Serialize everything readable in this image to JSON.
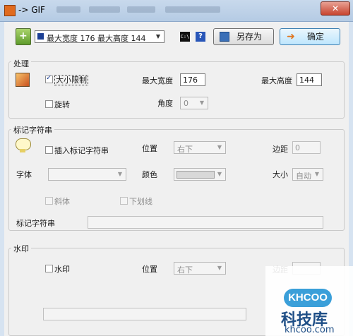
{
  "window": {
    "title": "-> GIF",
    "close_glyph": "✕"
  },
  "toolbar": {
    "preset_value": "最大宽度 176 最大高度 144",
    "cmd_icon_text": "C:\\",
    "help_icon_text": "?",
    "save_as_label": "另存为",
    "ok_label": "确定"
  },
  "processing": {
    "title": "处理",
    "size_limit_label": "大小限制",
    "size_limit_checked": true,
    "max_width_label": "最大宽度",
    "max_width_value": "176",
    "max_height_label": "最大高度",
    "max_height_value": "144",
    "rotate_label": "旋转",
    "rotate_checked": false,
    "angle_label": "角度",
    "angle_value": "0"
  },
  "mark_string": {
    "title": "标记字符串",
    "insert_label": "插入标记字符串",
    "insert_checked": false,
    "position_label": "位置",
    "position_value": "右下",
    "margin_label": "边距",
    "margin_value": "0",
    "font_label": "字体",
    "font_value": "",
    "color_label": "颜色",
    "size_label": "大小",
    "size_value": "自动",
    "italic_label": "斜体",
    "underline_label": "下划线",
    "string_label": "标记字符串",
    "string_value": ""
  },
  "watermark": {
    "title": "水印",
    "watermark_label": "水印",
    "watermark_checked": false,
    "position_label": "位置",
    "position_value": "右下",
    "margin_label": "边距",
    "path_value": ""
  },
  "site_watermark": {
    "logo": "KHCOO",
    "name": "科技库",
    "url": "khcoo.com"
  },
  "colors": {
    "title_bar": "#b5cbe4",
    "client_bg": "#f0f0f0",
    "accent": "#3c7fb1"
  }
}
